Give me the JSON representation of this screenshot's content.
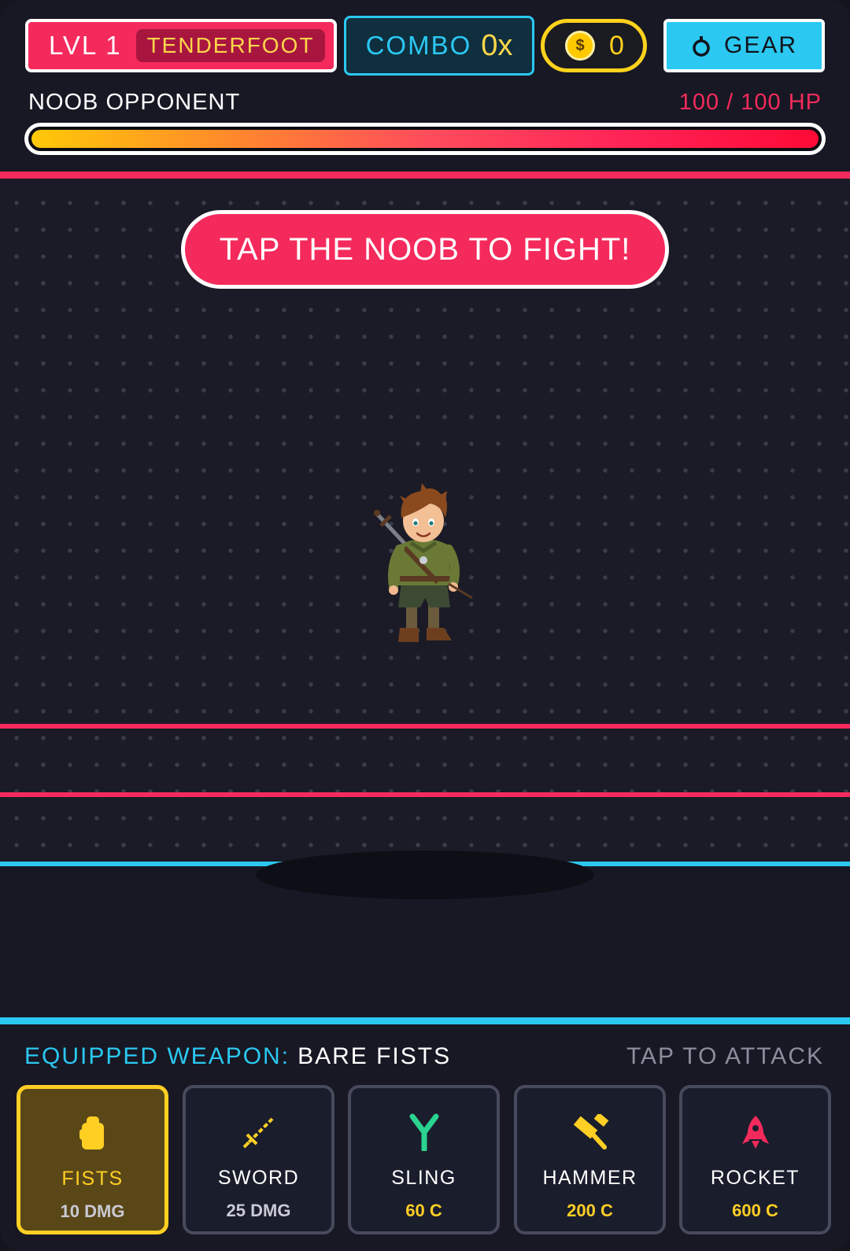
{
  "hud": {
    "level_label": "LVL 1",
    "rank": "TENDERFOOT",
    "combo_label": "COMBO",
    "combo_value": "0x",
    "coin_symbol": "$",
    "coins": "0",
    "gear_label": "GEAR",
    "gear_icon": "ring-icon"
  },
  "opponent": {
    "name": "NOOB OPPONENT",
    "hp_text": "100 / 100 HP",
    "hp_fraction": 1.0
  },
  "arena": {
    "banner": "TAP THE NOOB TO FIGHT!"
  },
  "panel": {
    "equipped_label": "EQUIPPED WEAPON:",
    "equipped_name": "BARE FISTS",
    "hint": "TAP TO ATTACK"
  },
  "weapons": [
    {
      "name": "FISTS",
      "stat": "10 DMG",
      "icon": "fist-icon",
      "selected": true
    },
    {
      "name": "SWORD",
      "stat": "25 DMG",
      "icon": "sword-icon",
      "selected": false
    },
    {
      "name": "SLING",
      "stat": "60 C",
      "icon": "slingshot-icon",
      "selected": false
    },
    {
      "name": "HAMMER",
      "stat": "200 C",
      "icon": "hammer-icon",
      "selected": false
    },
    {
      "name": "ROCKET",
      "stat": "600 C",
      "icon": "rocket-icon",
      "selected": false
    }
  ],
  "colors": {
    "accent_pink": "#f52a5c",
    "accent_cyan": "#2bc8f1",
    "accent_gold": "#ffcf24",
    "background": "#171824"
  }
}
